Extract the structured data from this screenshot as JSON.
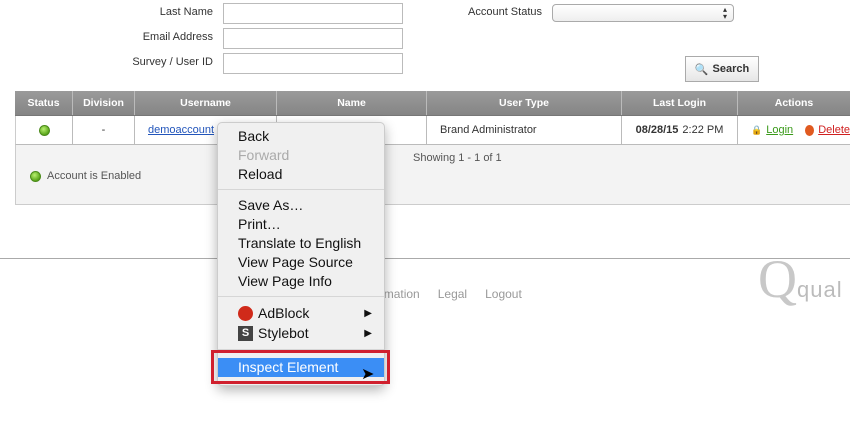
{
  "form": {
    "last_name_label": "Last Name",
    "email_label": "Email Address",
    "survey_label": "Survey / User ID",
    "account_status_label": "Account Status",
    "account_status_value": "",
    "search_button": "Search"
  },
  "table": {
    "headers": [
      "Status",
      "Division",
      "Username",
      "Name",
      "User Type",
      "Last Login",
      "Actions"
    ],
    "rows": [
      {
        "division": "-",
        "username": "demoaccount",
        "name": "",
        "user_type": "Brand Administrator",
        "last_login_date": "08/28/15",
        "last_login_time": "2:22 PM",
        "login": "Login",
        "delete": "Delete"
      }
    ],
    "pagination": "Showing 1 - 1 of 1",
    "legend": "Account is Enabled"
  },
  "footer": {
    "links": [
      "Contact Information",
      "Legal",
      "Logout"
    ],
    "logo_text": "qualtrics"
  },
  "context_menu": {
    "items": [
      "Back",
      "Forward",
      "Reload",
      "Save As…",
      "Print…",
      "Translate to English",
      "View Page Source",
      "View Page Info",
      "AdBlock",
      "Stylebot",
      "Inspect Element"
    ]
  },
  "colors": {
    "highlight": "#3b8ef5",
    "annotation": "#d0202e",
    "link": "#2255bb"
  }
}
